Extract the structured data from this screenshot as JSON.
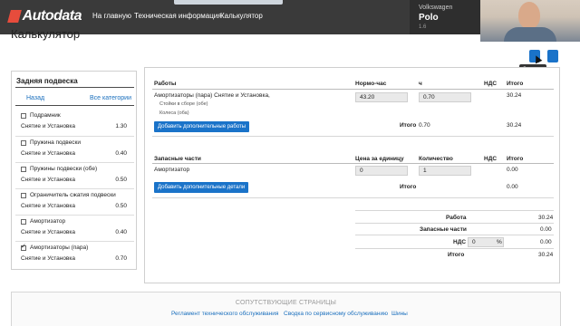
{
  "header": {
    "logo_text": "Autodata",
    "nav": [
      "На главную",
      "Техническая информация",
      "Калькулятор"
    ],
    "vehicle": {
      "make": "Volkswagen",
      "model": "Polo",
      "engine": "1.6"
    }
  },
  "page": {
    "title": "Калькулятор",
    "export_tooltip": "Экспорт"
  },
  "sidebar": {
    "title": "Задняя подвеска",
    "back_label": "Назад",
    "all_categories_label": "Все категории",
    "items": [
      {
        "name": "Подрамник",
        "operation": "Снятие и Установка",
        "time": "1.30",
        "checked": false
      },
      {
        "name": "Пружина подвески",
        "operation": "Снятие и Установка",
        "time": "0.40",
        "checked": false
      },
      {
        "name": "Пружины подвески (обе)",
        "operation": "Снятие и Установка",
        "time": "0.50",
        "checked": false
      },
      {
        "name": "Ограничитель сжатия подвески",
        "operation": "Снятие и Установка",
        "time": "0.50",
        "checked": false
      },
      {
        "name": "Амортизатор",
        "operation": "Снятие и Установка",
        "time": "0.40",
        "checked": false
      },
      {
        "name": "Амортизаторы (пара)",
        "operation": "Снятие и Установка",
        "time": "0.70",
        "checked": true
      }
    ]
  },
  "works": {
    "headers": {
      "work": "Работы",
      "norm_hours": "Нормо-час",
      "h": "ч",
      "vat": "НДС",
      "total": "Итого"
    },
    "row": {
      "title": "Амортизаторы (пара) Снятие и Установка,",
      "sub1": "Стойки в сборе (обе)",
      "sub2": "Колеса (оба)",
      "norm_hours": "43.20",
      "hours": "0.70",
      "total": "30.24"
    },
    "add_button": "Добавить дополнительные работы",
    "total_label": "Итого",
    "total_hours": "0.70",
    "total_value": "30.24"
  },
  "parts": {
    "headers": {
      "part": "Запасные части",
      "unit_price": "Цена за единицу",
      "qty": "Количество",
      "vat": "НДС",
      "total": "Итого"
    },
    "row": {
      "name": "Амортизатор",
      "unit_price": "0",
      "qty": "1",
      "total": "0.00"
    },
    "add_button": "Добавить дополнительные детали",
    "total_label": "Итого",
    "total_value": "0.00"
  },
  "summary": {
    "work_label": "Работа",
    "work_value": "30.24",
    "parts_label": "Запасные части",
    "parts_value": "0.00",
    "vat_label": "НДС",
    "vat_input": "0",
    "vat_percent": "%",
    "vat_value": "0.00",
    "total_label": "Итого",
    "total_value": "30.24"
  },
  "footer": {
    "title": "СОПУТСТВУЮЩИЕ СТРАНИЦЫ",
    "links": [
      "Регламент технического обслуживания",
      "Сводка по сервисному обслуживанию",
      "Шины"
    ]
  }
}
